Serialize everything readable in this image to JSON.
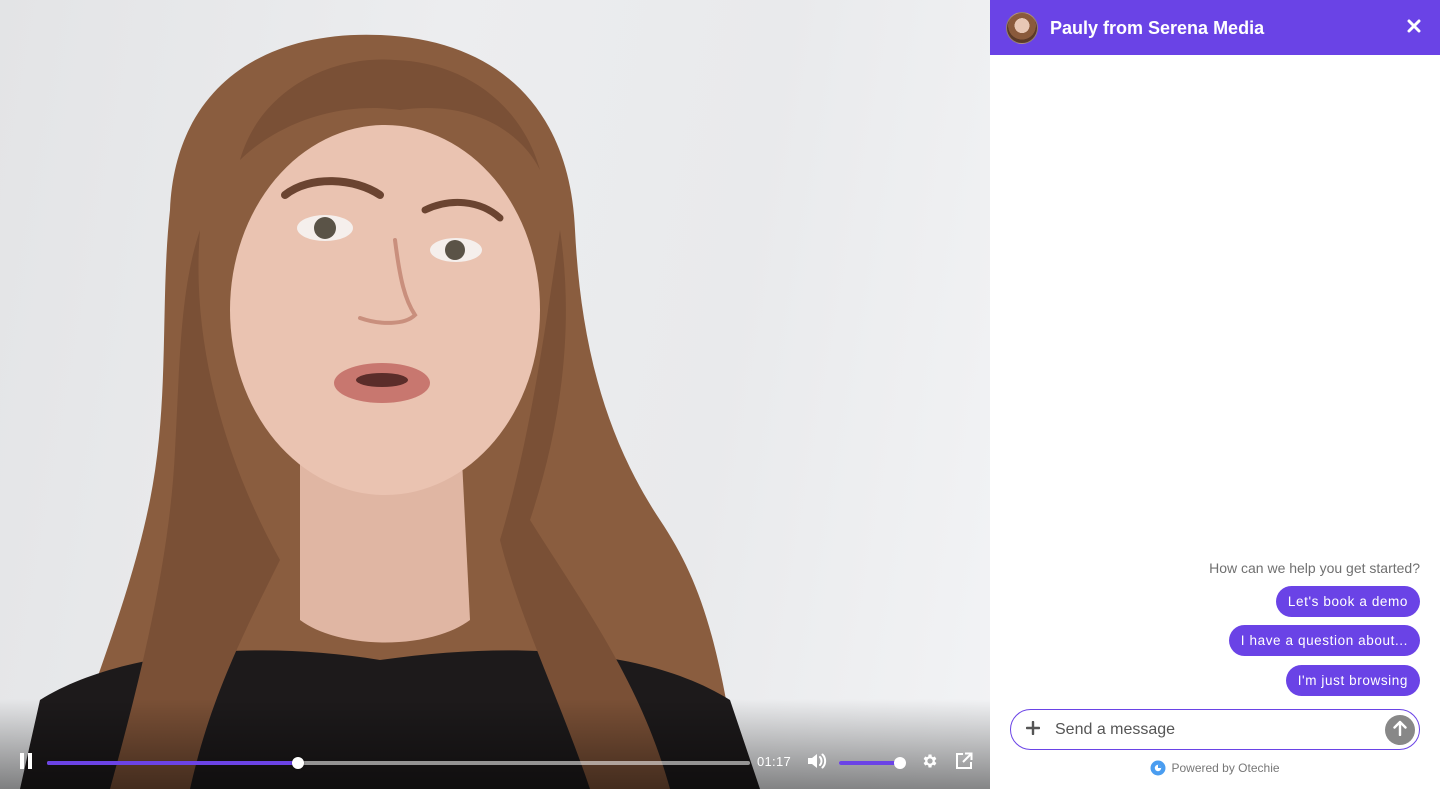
{
  "video": {
    "elapsed": "01:17",
    "progress": 0.357,
    "volume": 0.98,
    "icons": [
      "pause-icon",
      "volume-icon",
      "gear-icon",
      "popout-icon"
    ]
  },
  "chat": {
    "title": "Pauly from Serena Media",
    "prompt": "How can we help you get started?",
    "quick_replies": [
      "Let's book a demo",
      "I have a question about...",
      "I'm just browsing"
    ],
    "input_placeholder": "Send a message",
    "powered_by": "Powered by Otechie"
  },
  "colors": {
    "accent": "#6a43e6",
    "send_button": "#888888"
  }
}
